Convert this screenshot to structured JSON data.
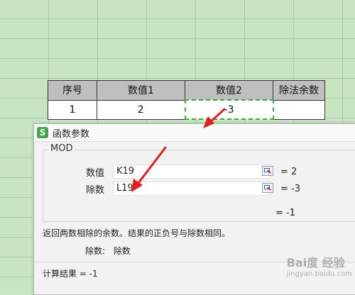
{
  "sheet": {
    "headers": [
      "序号",
      "数值1",
      "数值2",
      "除法余数"
    ],
    "row": [
      "1",
      "2",
      "-3",
      ""
    ]
  },
  "dialog": {
    "title": "函数参数",
    "icon_letter": "S",
    "function_name": "MOD",
    "args": [
      {
        "label": "数值",
        "value": "K19",
        "result": "= 2"
      },
      {
        "label": "除数",
        "value": "L19",
        "result": "= -3"
      }
    ],
    "overall_result": "= -1",
    "description": "返回两数相除的余数。结果的正负号与除数相同。",
    "param_label": "除数:",
    "param_desc": "除数",
    "calc_result": "计算结果 = -1"
  },
  "watermark": {
    "text": "Bai度 经验",
    "sub": "jingyan.baidu.com"
  },
  "colors": {
    "accent": "#3ea83a",
    "arrow": "#e0201e",
    "header_bg": "#bfbfbf"
  }
}
